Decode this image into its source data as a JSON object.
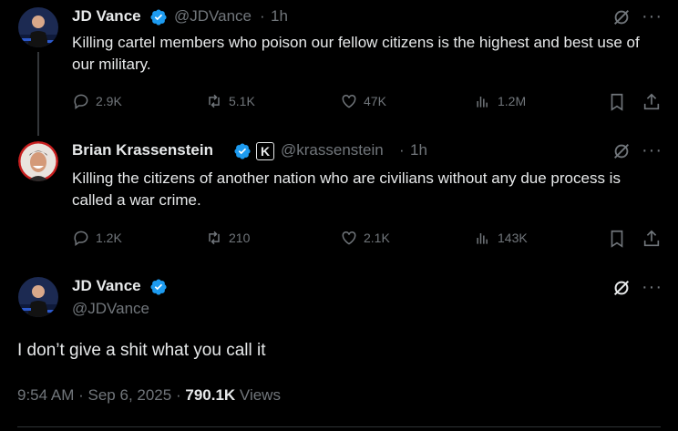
{
  "tweet1": {
    "name": "JD Vance",
    "handle": "@JDVance",
    "sep": "·",
    "time": "1h",
    "text": "Killing cartel members who poison our fellow citizens is the highest and best use of our military.",
    "replies": "2.9K",
    "reposts": "5.1K",
    "likes": "47K",
    "views": "1.2M"
  },
  "tweet2": {
    "name": "Brian Krassenstein",
    "handle": "@krassenstein",
    "sep": "·",
    "time": "1h",
    "affiliate_letter": "K",
    "text": "Killing the citizens of another nation who are civilians without any due process is called a war crime.",
    "replies": "1.2K",
    "reposts": "210",
    "likes": "2.1K",
    "views": "143K"
  },
  "main": {
    "name": "JD Vance",
    "handle": "@JDVance",
    "text": "I don’t give a shit what you call it",
    "time": "9:54 AM",
    "date": "Sep 6, 2025",
    "sep": "·",
    "views_count": "790.1K",
    "views_label": "Views"
  },
  "icons": {
    "more": "···",
    "verified": "verified-badge-icon",
    "grok": "grok-icon"
  },
  "colors": {
    "verified_blue": "#1d9bf0",
    "muted": "#71767b",
    "text": "#e7e9ea",
    "background": "#000000"
  }
}
